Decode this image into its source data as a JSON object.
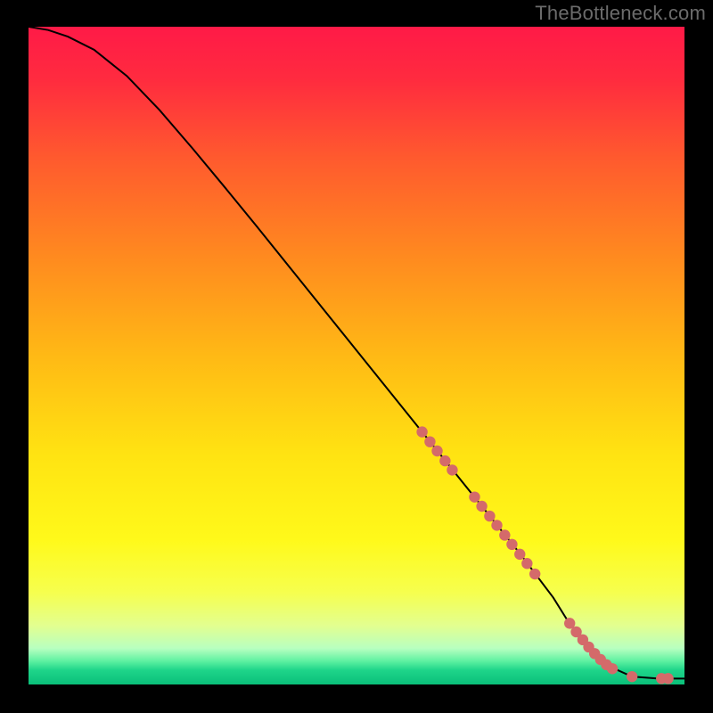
{
  "watermark": "TheBottleneck.com",
  "chart_data": {
    "type": "line",
    "title": "",
    "xlabel": "",
    "ylabel": "",
    "xlim": [
      0,
      100
    ],
    "ylim": [
      0,
      100
    ],
    "grid": false,
    "legend": false,
    "gradient_stops": [
      {
        "offset": 0.0,
        "color": "#ff1a47"
      },
      {
        "offset": 0.08,
        "color": "#ff2b3f"
      },
      {
        "offset": 0.2,
        "color": "#ff5a2e"
      },
      {
        "offset": 0.35,
        "color": "#ff8a1f"
      },
      {
        "offset": 0.5,
        "color": "#ffb915"
      },
      {
        "offset": 0.65,
        "color": "#ffe312"
      },
      {
        "offset": 0.78,
        "color": "#fff91a"
      },
      {
        "offset": 0.86,
        "color": "#f6ff4e"
      },
      {
        "offset": 0.91,
        "color": "#e3ff8f"
      },
      {
        "offset": 0.945,
        "color": "#b8ffc0"
      },
      {
        "offset": 0.965,
        "color": "#5bf0a0"
      },
      {
        "offset": 0.978,
        "color": "#1fd58a"
      },
      {
        "offset": 1.0,
        "color": "#0abf79"
      }
    ],
    "series": [
      {
        "name": "curve",
        "stroke": "#000000",
        "x": [
          0,
          3,
          6,
          10,
          15,
          20,
          25,
          30,
          35,
          40,
          45,
          50,
          55,
          60,
          65,
          70,
          75,
          80,
          82,
          85,
          88,
          92,
          96,
          100
        ],
        "y": [
          100,
          99.5,
          98.5,
          96.5,
          92.5,
          87.3,
          81.5,
          75.5,
          69.4,
          63.2,
          57.0,
          50.8,
          44.6,
          38.4,
          32.2,
          26.0,
          19.8,
          13.2,
          10.0,
          6.2,
          3.0,
          1.2,
          0.9,
          0.9
        ]
      }
    ],
    "highlight_points": {
      "color": "#d46a6a",
      "radius": 6.2,
      "x": [
        60.0,
        61.2,
        62.3,
        63.5,
        64.6,
        68.0,
        69.1,
        70.3,
        71.4,
        72.6,
        73.7,
        74.9,
        76.0,
        77.2,
        82.5,
        83.5,
        84.5,
        85.4,
        86.3,
        87.2,
        88.1,
        89.0,
        92.0,
        96.5,
        97.5
      ],
      "y": [
        38.4,
        36.9,
        35.5,
        34.0,
        32.6,
        28.5,
        27.1,
        25.6,
        24.2,
        22.7,
        21.3,
        19.8,
        18.4,
        16.8,
        9.3,
        8.0,
        6.8,
        5.7,
        4.7,
        3.8,
        3.0,
        2.4,
        1.2,
        0.9,
        0.9
      ]
    }
  }
}
